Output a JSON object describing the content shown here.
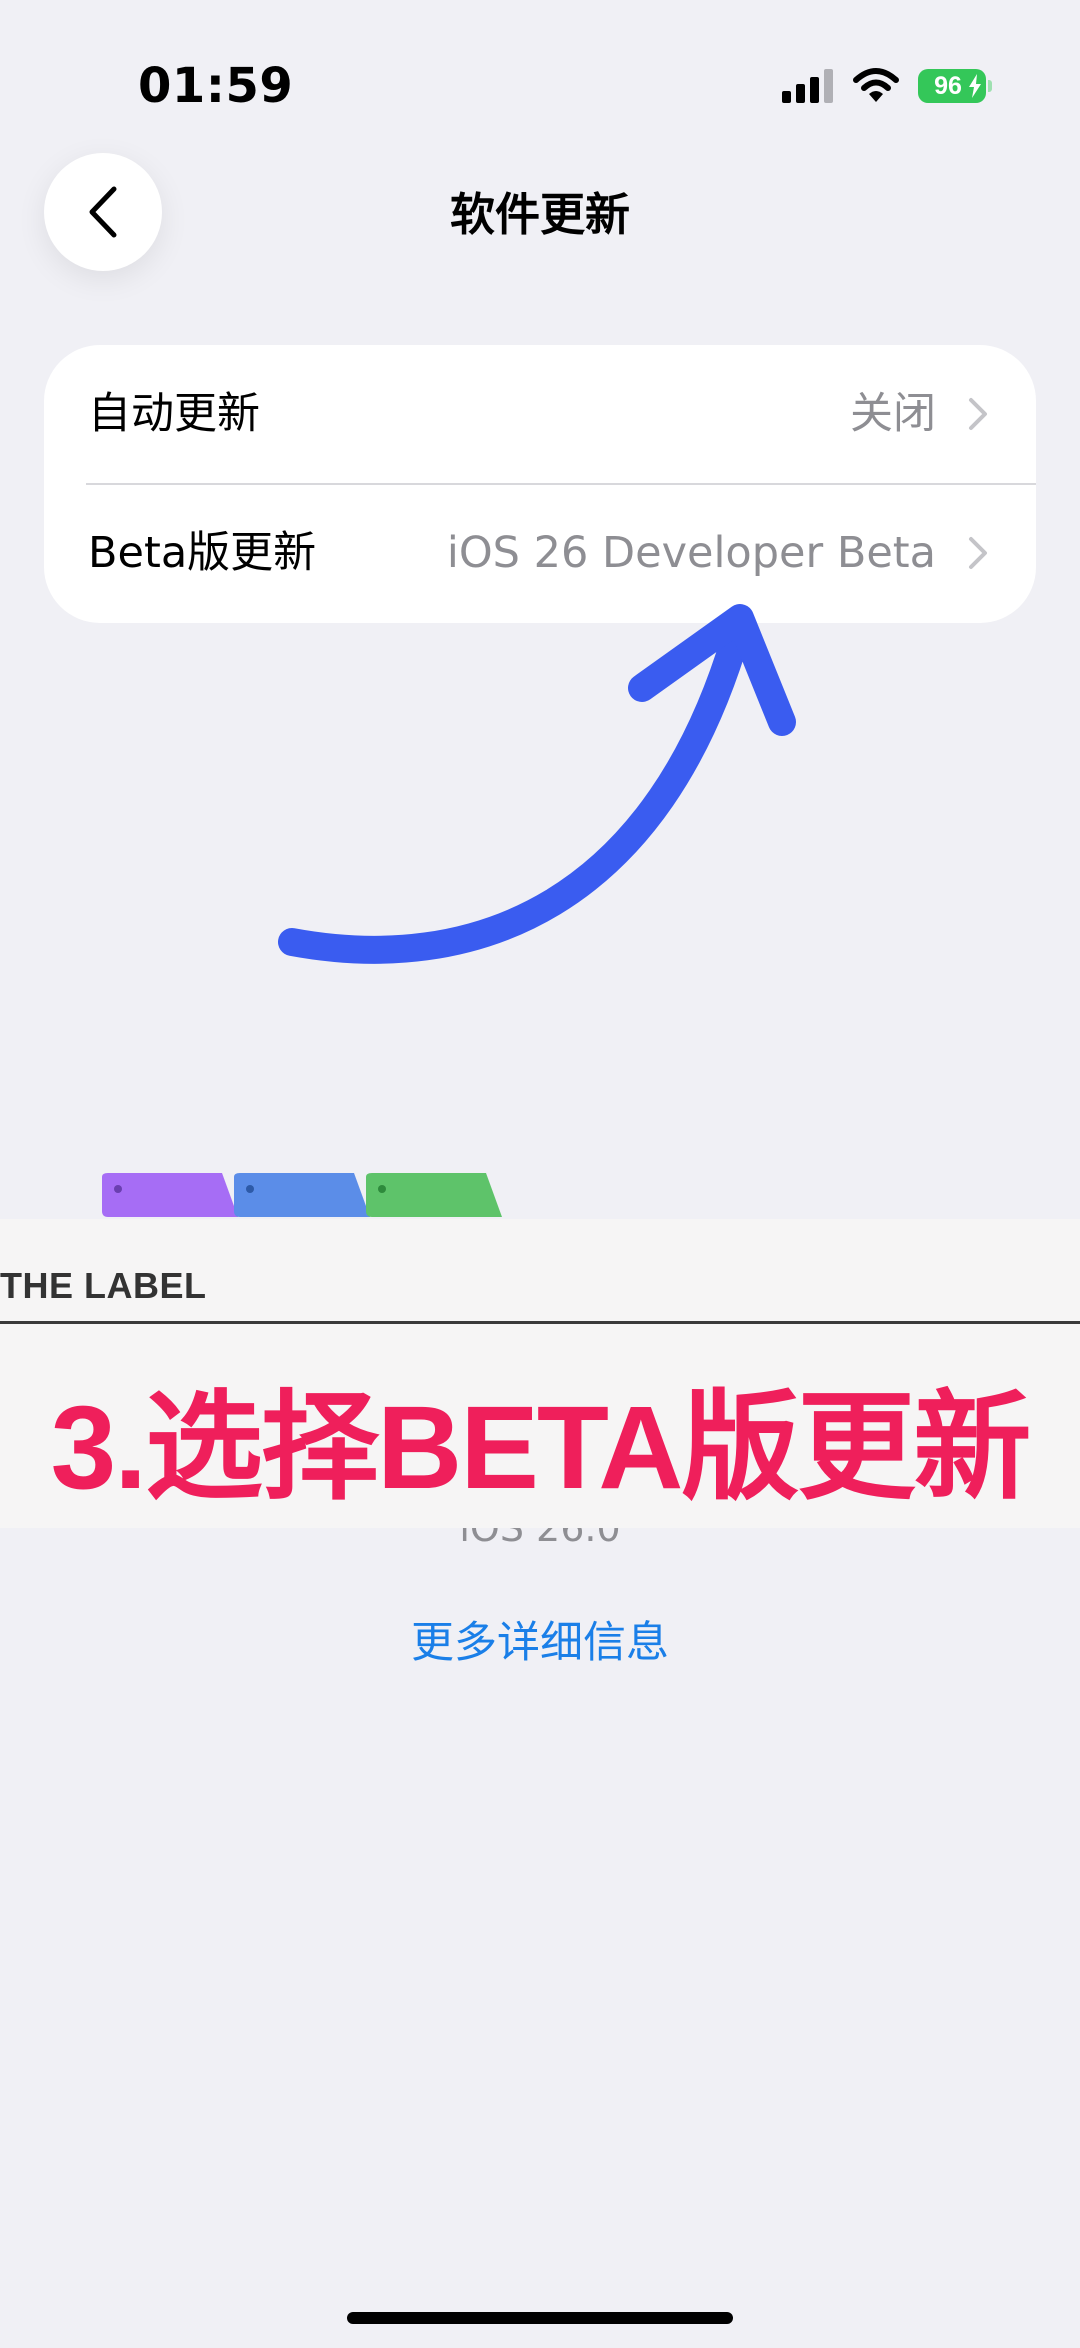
{
  "status_bar": {
    "time": "01:59",
    "battery_level": "96",
    "icons": [
      "cellular-signal-icon",
      "wifi-icon",
      "battery-charging-icon"
    ]
  },
  "nav": {
    "title": "软件更新",
    "back_icon": "chevron-left-icon"
  },
  "settings": {
    "rows": [
      {
        "label": "自动更新",
        "value": "关闭"
      },
      {
        "label": "Beta版更新",
        "value": "iOS 26 Developer Beta"
      }
    ]
  },
  "annotation": {
    "arrow_color": "#3a5cf0",
    "label_header": "THE LABEL",
    "caption": "3.选择BETA版更新",
    "caption_color": "#ef1f5b",
    "tab_colors": [
      "#a66df5",
      "#5b8de8",
      "#5ec36a"
    ]
  },
  "content": {
    "os_version": "iOS 26.0",
    "more_info_link": "更多详细信息",
    "link_color": "#1a7fe8"
  }
}
